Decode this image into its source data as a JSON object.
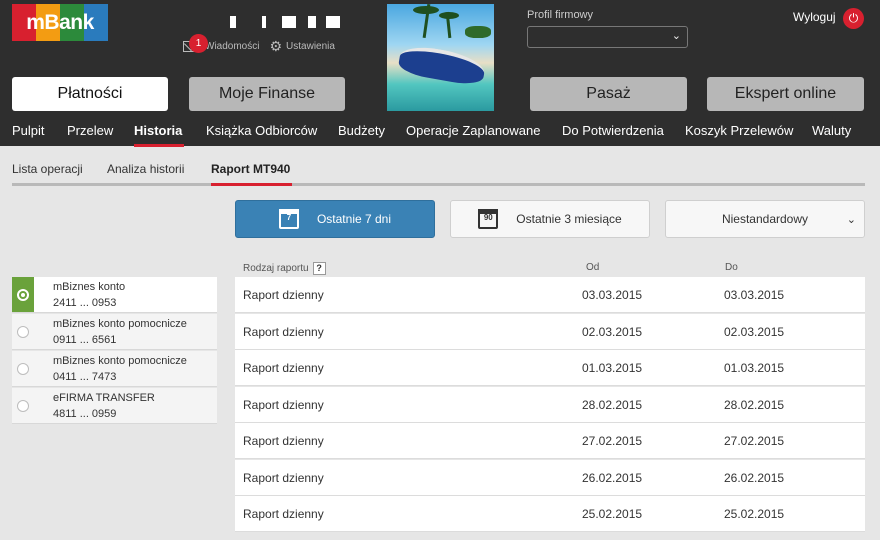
{
  "brand": {
    "logo_text": "mBank",
    "colors": [
      "#d8202f",
      "#f39c12",
      "#2c8a3b",
      "#2a7bbd"
    ]
  },
  "header": {
    "messages_label": "Wiadomości",
    "messages_count": "1",
    "settings_label": "Ustawienia",
    "profile_label": "Profil firmowy",
    "profile_value": "",
    "logout_label": "Wyloguj",
    "accent": "#d8202f"
  },
  "main_buttons": [
    {
      "label": "Płatności",
      "active": true
    },
    {
      "label": "Moje Finanse",
      "active": false
    },
    {
      "label": "Pasaż",
      "active": false
    },
    {
      "label": "Ekspert online",
      "active": false
    }
  ],
  "nav": [
    "Pulpit",
    "Przelew",
    "Historia",
    "Książka Odbiorców",
    "Budżety",
    "Operacje Zaplanowane",
    "Do Potwierdzenia",
    "Koszyk Przelewów",
    "Waluty"
  ],
  "nav_active": "Historia",
  "subtabs": [
    "Lista operacji",
    "Analiza historii",
    "Raport MT940"
  ],
  "subtab_active": "Raport MT940",
  "periods": [
    {
      "label": "Ostatnie 7 dni",
      "icon": "calendar-icon",
      "icon_text": "7",
      "active": true
    },
    {
      "label": "Ostatnie 3 miesiące",
      "icon": "calendar-icon",
      "icon_text": "90",
      "active": false
    },
    {
      "label": "Niestandardowy",
      "icon": "chevron-down-icon",
      "active": false
    }
  ],
  "accounts": [
    {
      "name": "mBiznes konto",
      "number": "2411 ... 0953",
      "selected": true
    },
    {
      "name": "mBiznes konto pomocnicze",
      "number": "0911 ... 6561",
      "selected": false
    },
    {
      "name": "mBiznes konto pomocnicze",
      "number": "0411 ... 7473",
      "selected": false
    },
    {
      "name": "eFIRMA TRANSFER",
      "number": "4811 ... 0959",
      "selected": false
    }
  ],
  "table": {
    "columns": {
      "type": "Rodzaj raportu",
      "from": "Od",
      "to": "Do",
      "help": "?"
    },
    "rows": [
      {
        "type": "Raport dzienny",
        "from": "03.03.2015",
        "to": "03.03.2015"
      },
      {
        "type": "Raport dzienny",
        "from": "02.03.2015",
        "to": "02.03.2015"
      },
      {
        "type": "Raport dzienny",
        "from": "01.03.2015",
        "to": "01.03.2015"
      },
      {
        "type": "Raport dzienny",
        "from": "28.02.2015",
        "to": "28.02.2015"
      },
      {
        "type": "Raport dzienny",
        "from": "27.02.2015",
        "to": "27.02.2015"
      },
      {
        "type": "Raport dzienny",
        "from": "26.02.2015",
        "to": "26.02.2015"
      },
      {
        "type": "Raport dzienny",
        "from": "25.02.2015",
        "to": "25.02.2015"
      }
    ]
  }
}
